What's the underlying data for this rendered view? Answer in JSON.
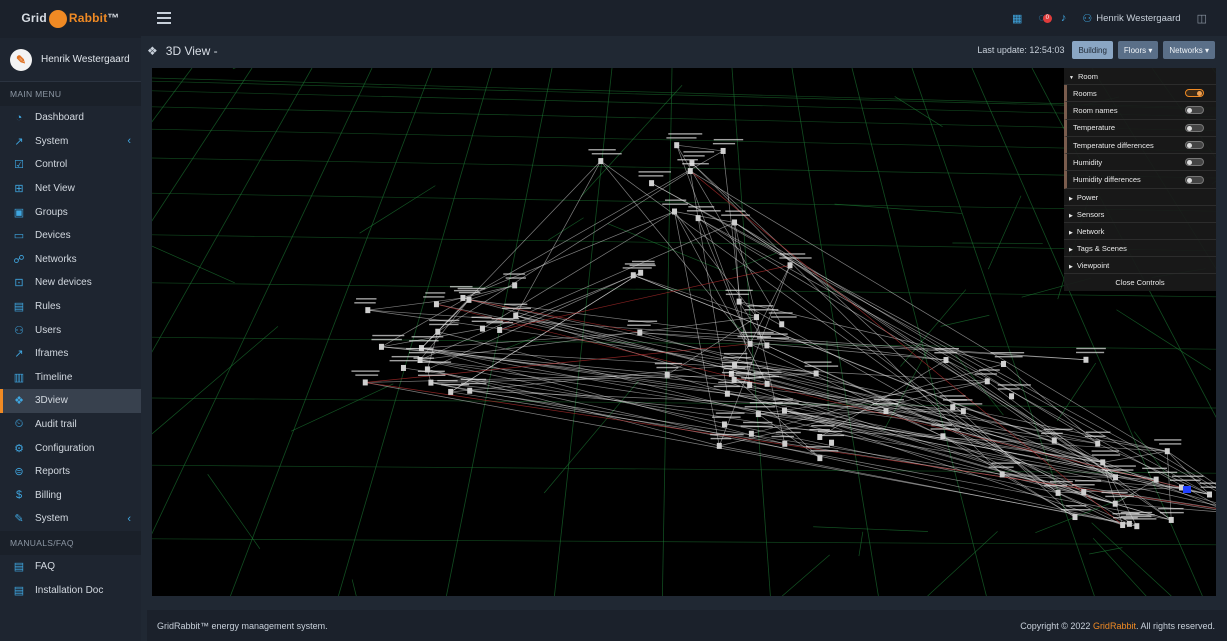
{
  "brand": {
    "part1": "Grid",
    "part2": "Rabbit",
    "tm": "™"
  },
  "user": {
    "name": "Henrik Westergaard"
  },
  "sidebar": {
    "main_menu_label": "MAIN MENU",
    "items": [
      {
        "label": "Dashboard",
        "icon": "dashboard-icon",
        "glyph": "◔"
      },
      {
        "label": "System",
        "icon": "system-icon",
        "glyph": "↗",
        "expandable": true
      },
      {
        "label": "Control",
        "icon": "control-icon",
        "glyph": "☑"
      },
      {
        "label": "Net View",
        "icon": "netview-icon",
        "glyph": "⊞"
      },
      {
        "label": "Groups",
        "icon": "groups-icon",
        "glyph": "▣"
      },
      {
        "label": "Devices",
        "icon": "devices-icon",
        "glyph": "▭"
      },
      {
        "label": "Networks",
        "icon": "networks-icon",
        "glyph": "☍"
      },
      {
        "label": "New devices",
        "icon": "new-devices-icon",
        "glyph": "⊡"
      },
      {
        "label": "Rules",
        "icon": "rules-icon",
        "glyph": "▤"
      },
      {
        "label": "Users",
        "icon": "users-icon",
        "glyph": "⚇"
      },
      {
        "label": "Iframes",
        "icon": "iframes-icon",
        "glyph": "↗"
      },
      {
        "label": "Timeline",
        "icon": "timeline-icon",
        "glyph": "▥"
      },
      {
        "label": "3Dview",
        "icon": "3dview-icon",
        "glyph": "❖",
        "active": true
      },
      {
        "label": "Audit trail",
        "icon": "audit-trail-icon",
        "glyph": "⏲"
      },
      {
        "label": "Configuration",
        "icon": "configuration-icon",
        "glyph": "⚙"
      },
      {
        "label": "Reports",
        "icon": "reports-icon",
        "glyph": "⊜"
      },
      {
        "label": "Billing",
        "icon": "billing-icon",
        "glyph": "$"
      },
      {
        "label": "System",
        "icon": "wrench-icon",
        "glyph": "✎",
        "expandable": true
      }
    ],
    "manuals_label": "MANUALS/FAQ",
    "manual_items": [
      {
        "label": "FAQ",
        "icon": "faq-icon",
        "glyph": "▤"
      },
      {
        "label": "Installation Doc",
        "icon": "doc-icon",
        "glyph": "▤"
      }
    ]
  },
  "topbar": {
    "notification_count": "0",
    "user_name": "Henrik Westergaard"
  },
  "page": {
    "title": "3D View -",
    "last_update_label": "Last update: 12:54:03",
    "buttons": {
      "building": "Building",
      "floors": "Floors",
      "networks": "Networks"
    }
  },
  "controls": {
    "room_folder": "Room",
    "room_rows": [
      {
        "label": "Rooms",
        "on": true
      },
      {
        "label": "Room names",
        "on": false
      },
      {
        "label": "Temperature",
        "on": false
      },
      {
        "label": "Temperature differences",
        "on": false
      },
      {
        "label": "Humidity",
        "on": false
      },
      {
        "label": "Humidity differences",
        "on": false
      }
    ],
    "folders": [
      "Power",
      "Sensors",
      "Network",
      "Tags & Scenes",
      "Viewpoint"
    ],
    "close_label": "Close Controls"
  },
  "footer": {
    "left": "GridRabbit™ energy management system.",
    "copyright_prefix": "Copyright © 2022 ",
    "copyright_brand": "GridRabbit",
    "copyright_suffix": ". All rights reserved."
  },
  "colors": {
    "accent": "#f08a24",
    "icon_blue": "#3fa6e0",
    "grid_green": "#1f8a3a",
    "link_white": "#e8e8e8"
  }
}
